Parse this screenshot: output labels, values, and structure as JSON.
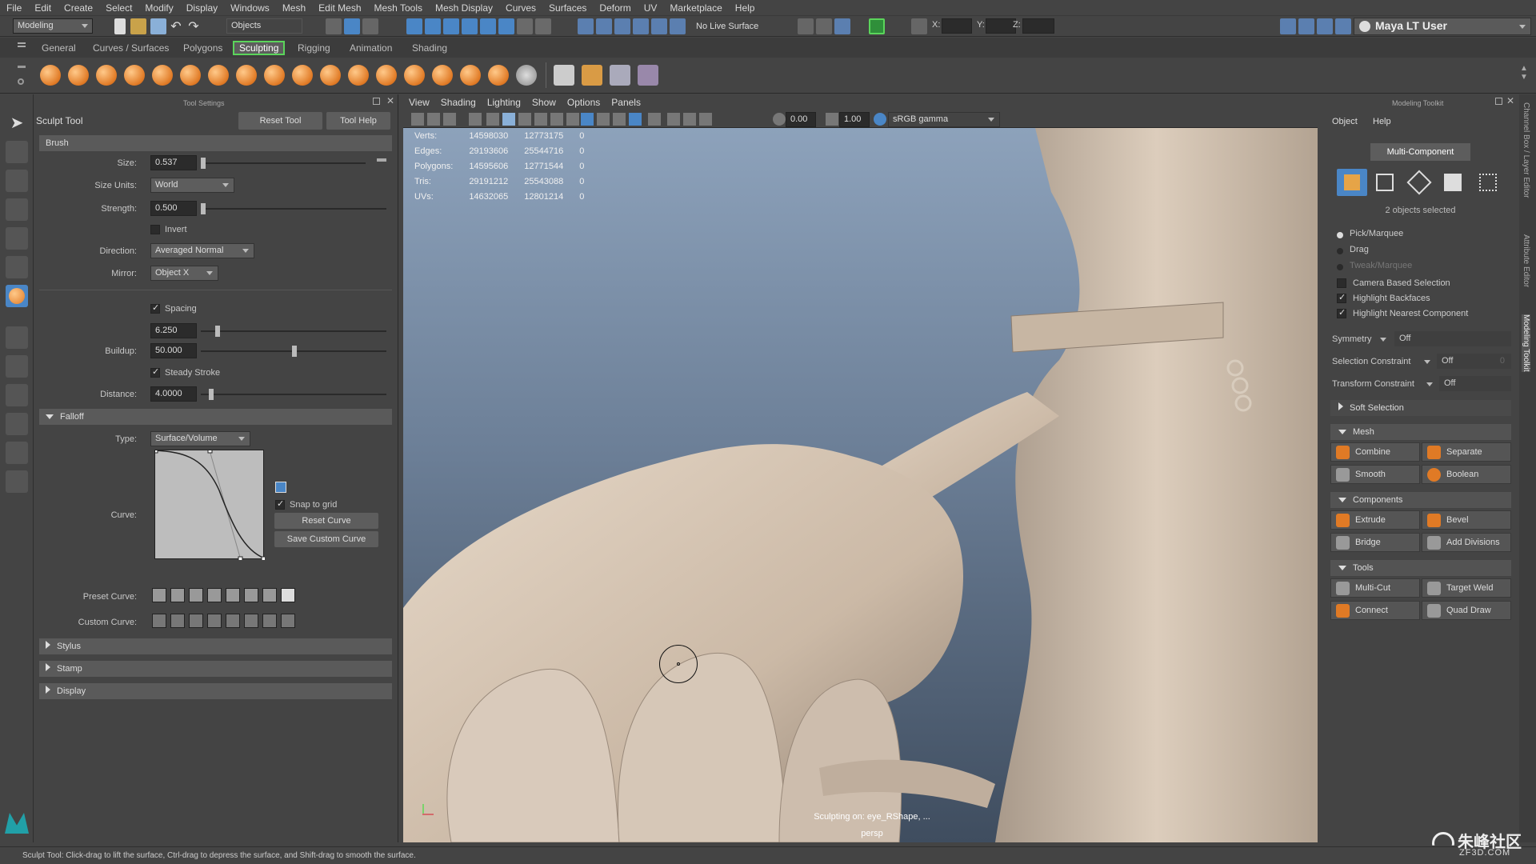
{
  "menubar": {
    "items": [
      "File",
      "Edit",
      "Create",
      "Select",
      "Modify",
      "Display",
      "Windows",
      "Mesh",
      "Edit Mesh",
      "Mesh Tools",
      "Mesh Display",
      "Curves",
      "Surfaces",
      "Deform",
      "UV",
      "Marketplace",
      "Help"
    ]
  },
  "statusline": {
    "mode": "Modeling",
    "objects_field": "Objects",
    "live_surface": "No Live Surface",
    "x_label": "X:",
    "y_label": "Y:",
    "z_label": "Z:",
    "user": "Maya LT User"
  },
  "shelf": {
    "tabs": [
      "General",
      "Curves / Surfaces",
      "Polygons",
      "Sculpting",
      "Rigging",
      "Animation",
      "Shading"
    ],
    "active_tab": "Sculpting"
  },
  "tool_settings": {
    "panel_title": "Tool Settings",
    "tool_name": "Sculpt Tool",
    "reset_tool": "Reset Tool",
    "tool_help": "Tool Help",
    "brush": {
      "title": "Brush",
      "size_label": "Size:",
      "size": "0.537",
      "size_units_label": "Size Units:",
      "size_units": "World",
      "strength_label": "Strength:",
      "strength": "0.500",
      "invert": "Invert",
      "direction_label": "Direction:",
      "direction": "Averaged Normal",
      "mirror_label": "Mirror:",
      "mirror": "Object X",
      "spacing": "Spacing",
      "spacing_value": "6.250",
      "buildup_label": "Buildup:",
      "buildup": "50.000",
      "steady_stroke": "Steady Stroke",
      "distance_label": "Distance:",
      "distance": "4.0000"
    },
    "falloff": {
      "title": "Falloff",
      "type_label": "Type:",
      "type": "Surface/Volume",
      "curve_label": "Curve:",
      "snap_to_grid": "Snap to grid",
      "reset_curve": "Reset Curve",
      "save_custom_curve": "Save Custom Curve",
      "preset_label": "Preset Curve:",
      "custom_label": "Custom Curve:"
    },
    "sections": [
      "Stylus",
      "Stamp",
      "Display"
    ]
  },
  "viewport": {
    "menu": [
      "View",
      "Shading",
      "Lighting",
      "Show",
      "Options",
      "Panels"
    ],
    "exposure": "0.00",
    "gamma": "1.00",
    "color_space": "sRGB gamma",
    "hud": [
      {
        "label": "Verts:",
        "a": "14598030",
        "b": "12773175",
        "c": "0"
      },
      {
        "label": "Edges:",
        "a": "29193606",
        "b": "25544716",
        "c": "0"
      },
      {
        "label": "Polygons:",
        "a": "14595606",
        "b": "12771544",
        "c": "0"
      },
      {
        "label": "Tris:",
        "a": "29191212",
        "b": "25543088",
        "c": "0"
      },
      {
        "label": "UVs:",
        "a": "14632065",
        "b": "12801214",
        "c": "0"
      }
    ],
    "sculpting_on": "Sculpting on: eye_RShape, ...",
    "camera": "persp"
  },
  "toolkit": {
    "title": "Modeling Toolkit",
    "menu": [
      "Object",
      "Help"
    ],
    "multi_component": "Multi-Component",
    "selected": "2 objects selected",
    "pick_marquee": "Pick/Marquee",
    "drag": "Drag",
    "tweak_marquee": "Tweak/Marquee",
    "camera_based": "Camera Based Selection",
    "highlight_backfaces": "Highlight Backfaces",
    "highlight_nearest": "Highlight Nearest Component",
    "symmetry_label": "Symmetry",
    "symmetry": "Off",
    "sel_constraint_label": "Selection Constraint",
    "sel_constraint": "Off",
    "sel_constraint_num": "0",
    "transform_constraint_label": "Transform Constraint",
    "transform_constraint": "Off",
    "soft_selection": "Soft Selection",
    "mesh": {
      "title": "Mesh",
      "combine": "Combine",
      "separate": "Separate",
      "smooth": "Smooth",
      "boolean": "Boolean"
    },
    "components": {
      "title": "Components",
      "extrude": "Extrude",
      "bevel": "Bevel",
      "bridge": "Bridge",
      "add_divisions": "Add Divisions"
    },
    "tools": {
      "title": "Tools",
      "multi_cut": "Multi-Cut",
      "target_weld": "Target Weld",
      "connect": "Connect",
      "quad_draw": "Quad Draw"
    }
  },
  "side_tabs": [
    "Channel Box / Layer Editor",
    "Attribute Editor",
    "Modeling Toolkit"
  ],
  "help_line": "Sculpt Tool: Click-drag to lift the surface, Ctrl-drag to depress the surface, and Shift-drag to smooth the surface.",
  "watermark": {
    "cn": "朱峰社区",
    "en": "ZF3D.COM"
  },
  "colors": {
    "accent_green": "#5bd55b",
    "toolkit_blue": "#4a86c6",
    "clay": "#d8c8b7"
  }
}
